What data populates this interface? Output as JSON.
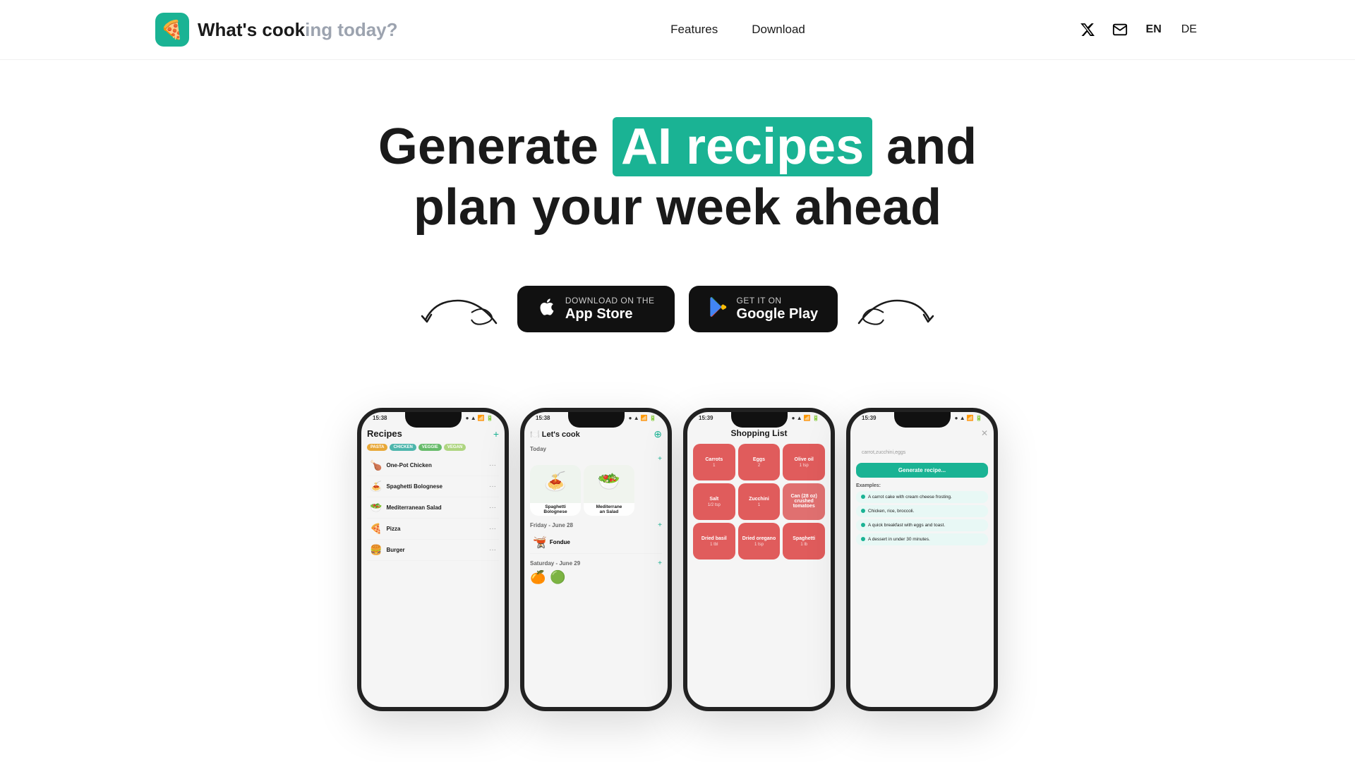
{
  "nav": {
    "logo_icon": "🍕",
    "logo_text_bold": "What's cook",
    "logo_text_light": "ing today?",
    "links": [
      {
        "label": "Features",
        "href": "#features"
      },
      {
        "label": "Download",
        "href": "#download"
      }
    ],
    "lang_en": "EN",
    "lang_de": "DE",
    "twitter_url": "#",
    "email_url": "#"
  },
  "hero": {
    "title_pre": "Generate ",
    "title_highlight": "AI recipes",
    "title_post": " and",
    "title_line2": "plan your week ahead"
  },
  "cta": {
    "appstore_sub": "Download on the",
    "appstore_main": "App Store",
    "googleplay_sub": "GET IT ON",
    "googleplay_main": "Google Play"
  },
  "phones": [
    {
      "id": "recipes",
      "status_time": "15:38",
      "title": "Recipes",
      "tags": [
        "PASTA",
        "CHICKEN",
        "VEGGIE",
        "VEGAN"
      ],
      "items": [
        {
          "emoji": "🍗",
          "name": "One-Pot Chicken"
        },
        {
          "emoji": "🍝",
          "name": "Spaghetti Bolognese"
        },
        {
          "emoji": "🥗",
          "name": "Mediterranean Salad"
        },
        {
          "emoji": "🍕",
          "name": "Pizza"
        },
        {
          "emoji": "🍔",
          "name": "Burger"
        }
      ]
    },
    {
      "id": "mealplan",
      "status_time": "15:38",
      "title": "🍽️ Let's cook",
      "sections": [
        {
          "label": "Today",
          "cards": [
            {
              "emoji": "🍝",
              "label": "Spaghetti Bolognese"
            },
            {
              "emoji": "🥗",
              "label": "Mediterranean Salad"
            }
          ]
        },
        {
          "label": "Friday - June 28",
          "items": [
            {
              "emoji": "🫕",
              "label": "Fondue"
            }
          ]
        },
        {
          "label": "Saturday - June 29",
          "items": []
        }
      ]
    },
    {
      "id": "shopping",
      "status_time": "15:39",
      "title": "Shopping List",
      "items": [
        {
          "name": "Carrots",
          "count": "1"
        },
        {
          "name": "Eggs",
          "count": "2"
        },
        {
          "name": "Olive oil",
          "count": "1 tsp"
        },
        {
          "name": "Salt",
          "count": "1/2 tsp"
        },
        {
          "name": "Zucchini",
          "count": "1"
        },
        {
          "name": "Can (28 oz) crushed tomatoes",
          "count": ""
        },
        {
          "name": "Dried basil",
          "count": "1 tbl"
        },
        {
          "name": "Dried oregano",
          "count": "1 tsp"
        },
        {
          "name": "Spaghetti",
          "count": "1 lb"
        }
      ]
    },
    {
      "id": "ai-generate",
      "status_time": "15:39",
      "input_value": "carrot,zucchini,eggs",
      "generate_label": "Generate recipe...",
      "examples_label": "Examples:",
      "examples": [
        "A carrot cake with cream cheese frosting.",
        "Chicken, rice, broccoli.",
        "A quick breakfast with eggs and toast.",
        "A dessert in under 30 minutes."
      ]
    }
  ]
}
